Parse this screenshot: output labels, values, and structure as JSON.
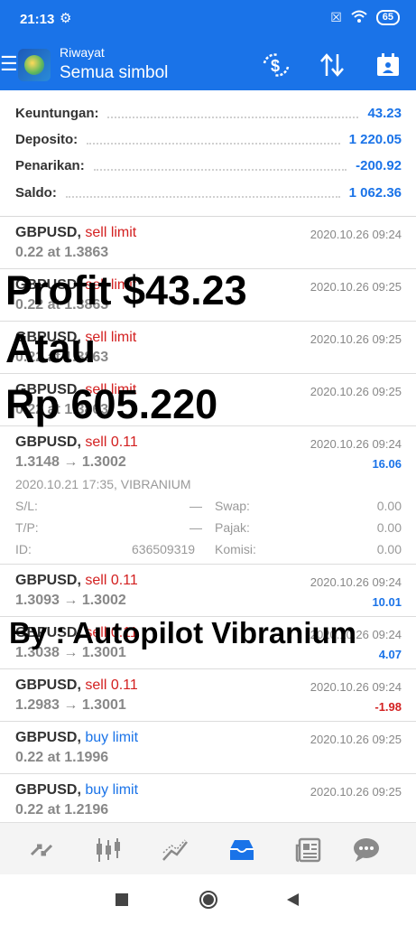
{
  "status": {
    "time": "21:13",
    "battery": "65"
  },
  "header": {
    "subtitle": "Riwayat",
    "title": "Semua simbol"
  },
  "summary": [
    {
      "label": "Keuntungan:",
      "value": "43.23"
    },
    {
      "label": "Deposito:",
      "value": "1 220.05"
    },
    {
      "label": "Penarikan:",
      "value": "-200.92"
    },
    {
      "label": "Saldo:",
      "value": "1 062.36"
    }
  ],
  "orders": [
    {
      "symbol": "GBPUSD,",
      "type": "sell limit",
      "datetime": "2020.10.26 09:24",
      "line2": "0.22 at 1.3863"
    },
    {
      "symbol": "GBPUSD,",
      "type": "sell limit",
      "datetime": "2020.10.26 09:25",
      "line2": "0.22 at 1.3863"
    },
    {
      "symbol": "GBPUSD,",
      "type": "sell limit",
      "datetime": "2020.10.26 09:25",
      "line2": "0.22 at 1.3863"
    },
    {
      "symbol": "GBPUSD,",
      "type": "sell limit",
      "datetime": "2020.10.26 09:25",
      "line2": "0.22 at 1.3863"
    },
    {
      "symbol": "GBPUSD,",
      "type": "sell 0.11",
      "datetime": "2020.10.26 09:24",
      "line2": "1.3148 → 1.3002",
      "profit": "16.06",
      "detail": {
        "opened": "2020.10.21 17:35, VIBRANIUM",
        "sl_label": "S/L:",
        "sl_value": "—",
        "tp_label": "T/P:",
        "tp_value": "—",
        "id_label": "ID:",
        "id_value": "636509319",
        "swap_label": "Swap:",
        "swap_value": "0.00",
        "pajak_label": "Pajak:",
        "pajak_value": "0.00",
        "komisi_label": "Komisi:",
        "komisi_value": "0.00"
      }
    },
    {
      "symbol": "GBPUSD,",
      "type": "sell 0.11",
      "datetime": "2020.10.26 09:24",
      "line2": "1.3093 → 1.3002",
      "profit": "10.01"
    },
    {
      "symbol": "GBPUSD,",
      "type": "sell 0.11",
      "datetime": "2020.10.26 09:24",
      "line2": "1.3038 → 1.3001",
      "profit": "4.07"
    },
    {
      "symbol": "GBPUSD,",
      "type": "sell 0.11",
      "datetime": "2020.10.26 09:24",
      "line2": "1.2983 → 1.3001",
      "profit": "-1.98"
    },
    {
      "symbol": "GBPUSD,",
      "type": "buy limit",
      "datetime": "2020.10.26 09:25",
      "line2": "0.22 at 1.1996"
    },
    {
      "symbol": "GBPUSD,",
      "type": "buy limit",
      "datetime": "2020.10.26 09:25",
      "line2": "0.22 at 1.2196"
    }
  ],
  "overlay": {
    "line1": "Profit $43.23",
    "line2": "Atau",
    "line3": "Rp 605.220",
    "byline": "By : Autopilot Vibranium"
  },
  "colors": {
    "accent": "#1a73e8",
    "sell": "#d32020",
    "buy": "#1a73e8",
    "negative": "#d32020"
  },
  "bottom_nav": [
    {
      "name": "quotes-icon"
    },
    {
      "name": "chart-icon"
    },
    {
      "name": "trade-icon"
    },
    {
      "name": "history-icon",
      "active": true
    },
    {
      "name": "news-icon"
    },
    {
      "name": "chat-icon"
    }
  ]
}
